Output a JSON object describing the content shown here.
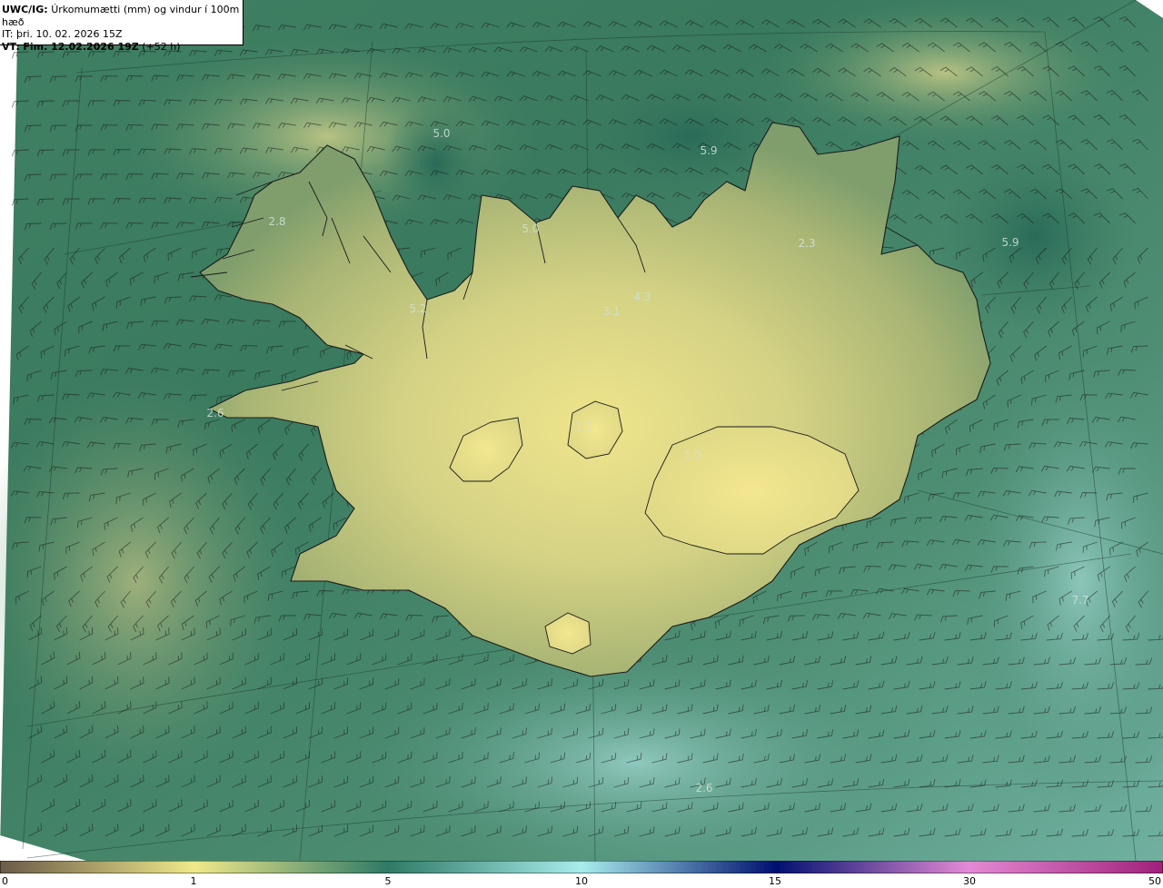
{
  "header": {
    "model": "UWC/IG:",
    "title": "Úrkomumætti (mm) og vindur í 100m hæð",
    "it_prefix": "IT:",
    "it_value": "þri. 10. 02. 2026 15Z",
    "vt_prefix": "VT:",
    "vt_value": "Fim. 12.02.2026 19Z",
    "vt_lead": "(+52 h)"
  },
  "colorbar": {
    "labels": [
      "0",
      "1",
      "5",
      "10",
      "15",
      "30",
      "50"
    ],
    "values": [
      0,
      1,
      5,
      10,
      15,
      30,
      50
    ],
    "colors": [
      "#6b5a48",
      "#f0e88a",
      "#2f7a66",
      "#a8ecec",
      "#001070",
      "#e48ad4",
      "#a0207a"
    ]
  },
  "map_values": [
    {
      "label": "5.0"
    },
    {
      "label": "5.9"
    },
    {
      "label": "2.8"
    },
    {
      "label": "5.0"
    },
    {
      "label": "2.3"
    },
    {
      "label": "5.9"
    },
    {
      "label": "5.2"
    },
    {
      "label": "4.3"
    },
    {
      "label": "3.1"
    },
    {
      "label": "2.6"
    },
    {
      "label": "1.1"
    },
    {
      "label": "1.0"
    },
    {
      "label": "7.7"
    },
    {
      "label": "2.6"
    }
  ],
  "colors": {
    "ocean_dark": "#2a6f5a",
    "ocean_mid": "#4a8a68",
    "ocean_light": "#6aa98a",
    "land_low": "#9aa86a",
    "land_high": "#e8e28a",
    "coast": "#1a1a1a"
  }
}
